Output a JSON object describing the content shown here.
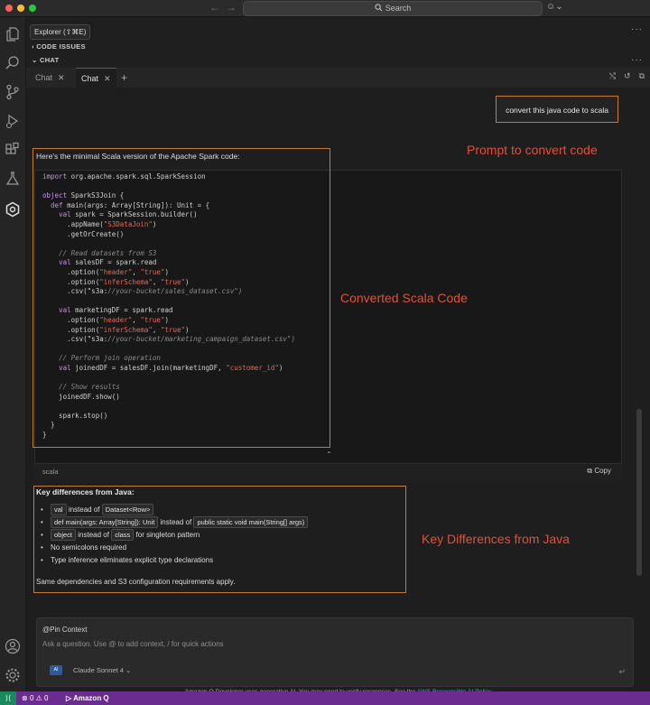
{
  "titlebar": {
    "search_placeholder": "Search",
    "traffic_lights": [
      "#ff5f57",
      "#febc2e",
      "#28c840"
    ]
  },
  "sidebar": {
    "explorer_tooltip": "Explorer (⇧⌘E)",
    "code_issues_title": "CODE ISSUES",
    "chat_title": "CHAT"
  },
  "tabs": [
    {
      "label": "Chat",
      "active": false
    },
    {
      "label": "Chat",
      "active": true
    }
  ],
  "chat": {
    "user_prompt": "convert this java code to scala",
    "intro": "Here's the minimal Scala version of the Apache Spark code:",
    "code_language": "scala",
    "copy_label": "Copy",
    "code_lines": [
      "import org.apache.spark.sql.SparkSession",
      "",
      "object SparkS3Join {",
      "  def main(args: Array[String]): Unit = {",
      "    val spark = SparkSession.builder()",
      "      .appName(\"S3DataJoin\")",
      "      .getOrCreate()",
      "",
      "    // Read datasets from S3",
      "    val salesDF = spark.read",
      "      .option(\"header\", \"true\")",
      "      .option(\"inferSchema\", \"true\")",
      "      .csv(\"s3a://your-bucket/sales_dataset.csv\")",
      "",
      "    val marketingDF = spark.read",
      "      .option(\"header\", \"true\")",
      "      .option(\"inferSchema\", \"true\")",
      "      .csv(\"s3a://your-bucket/marketing_campaign_dataset.csv\")",
      "",
      "    // Perform join operation",
      "    val joinedDF = salesDF.join(marketingDF, \"customer_id\")",
      "",
      "    // Show results",
      "    joinedDF.show()",
      "",
      "    spark.stop()",
      "  }",
      "}"
    ],
    "key_diff_title": "Key differences from Java:",
    "key_diffs": {
      "d1": {
        "a": "val",
        "b": "instead of",
        "c": "Dataset<Row>"
      },
      "d2": {
        "a": "def main(args: Array[String]): Unit",
        "b": "instead of",
        "c": "public static void main(String[] args)"
      },
      "d3": {
        "a": "object",
        "b": "instead of",
        "c": "class",
        "d": "for singleton pattern"
      },
      "d4": "No semicolons required",
      "d5": "Type inference eliminates explicit type declarations"
    },
    "key_diff_footer": "Same dependencies and S3 configuration requirements apply."
  },
  "annotations": {
    "prompt": "Prompt to convert code",
    "code": "Converted Scala Code",
    "diffs": "Key Differences from Java"
  },
  "input": {
    "pin_context": "@Pin Context",
    "placeholder": "Ask a question. Use @ to add context, / for quick actions",
    "model": "Claude Sonnet 4"
  },
  "disclaimer": {
    "text": "Amazon Q Developer uses generative AI. You may need to verify responses. See the",
    "link": "AWS Responsible AI Policy"
  },
  "statusbar": {
    "errors": "0",
    "warnings": "0",
    "amazon_q": "Amazon Q"
  },
  "colors": {
    "accent_orange": "#c7792c",
    "annotation_red": "#e0513b",
    "status_purple": "#6b2c8f"
  }
}
